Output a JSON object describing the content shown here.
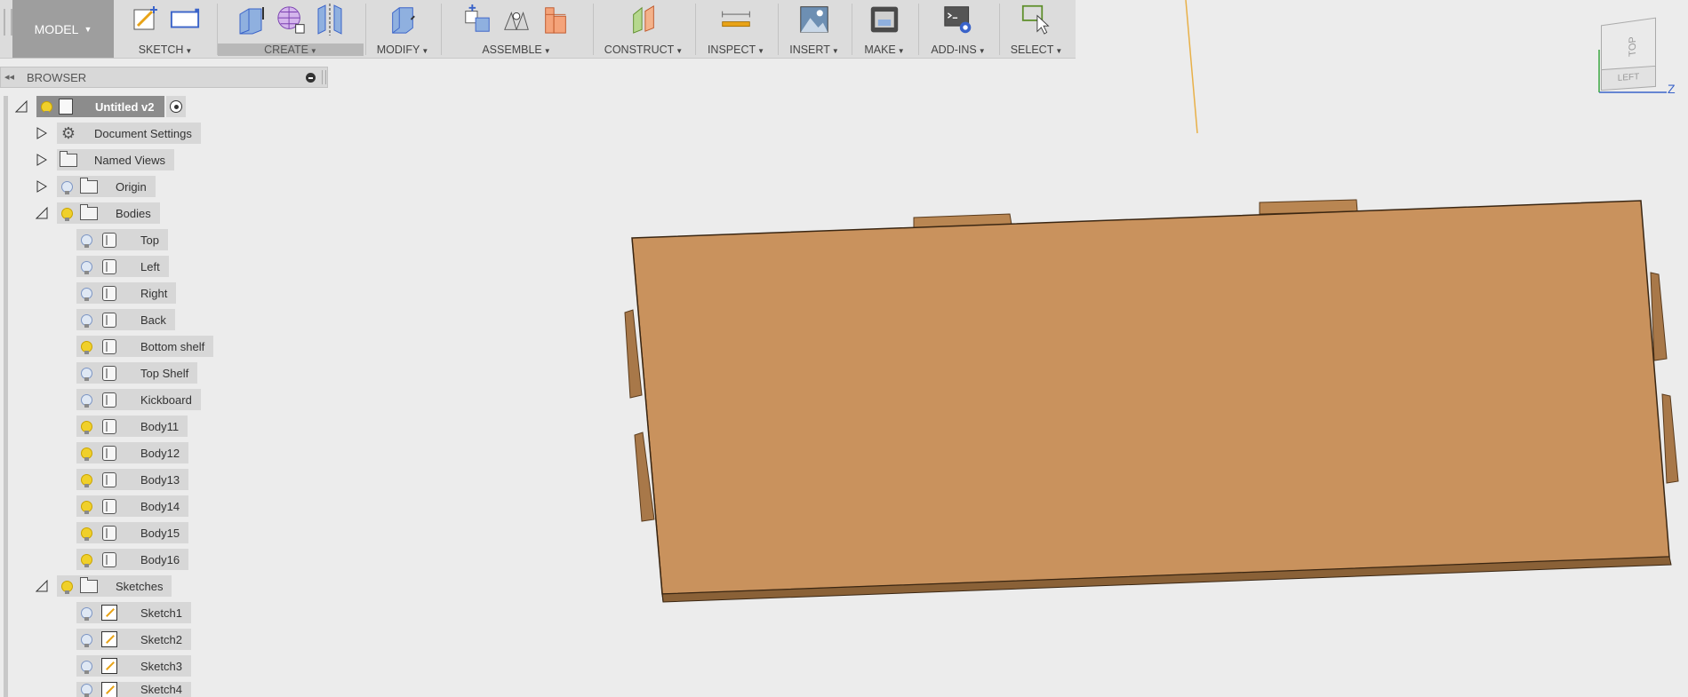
{
  "toolbar": {
    "workspace": "MODEL",
    "groups": [
      {
        "label": "SKETCH",
        "active": false
      },
      {
        "label": "CREATE",
        "active": true
      },
      {
        "label": "MODIFY",
        "active": false
      },
      {
        "label": "ASSEMBLE",
        "active": false
      },
      {
        "label": "CONSTRUCT",
        "active": false
      },
      {
        "label": "INSPECT",
        "active": false
      },
      {
        "label": "INSERT",
        "active": false
      },
      {
        "label": "MAKE",
        "active": false
      },
      {
        "label": "ADD-INS",
        "active": false
      },
      {
        "label": "SELECT",
        "active": false
      }
    ]
  },
  "browser": {
    "title": "BROWSER",
    "root": "Untitled v2",
    "items": [
      {
        "label": "Document Settings"
      },
      {
        "label": "Named Views"
      },
      {
        "label": "Origin"
      },
      {
        "label": "Bodies"
      }
    ],
    "bodies": [
      {
        "label": "Top",
        "visible": false
      },
      {
        "label": "Left",
        "visible": false
      },
      {
        "label": "Right",
        "visible": false
      },
      {
        "label": "Back",
        "visible": false
      },
      {
        "label": "Bottom shelf",
        "visible": true
      },
      {
        "label": "Top Shelf",
        "visible": false
      },
      {
        "label": "Kickboard",
        "visible": false
      },
      {
        "label": "Body11",
        "visible": true
      },
      {
        "label": "Body12",
        "visible": true
      },
      {
        "label": "Body13",
        "visible": true
      },
      {
        "label": "Body14",
        "visible": true
      },
      {
        "label": "Body15",
        "visible": true
      },
      {
        "label": "Body16",
        "visible": true
      }
    ],
    "sketches_label": "Sketches",
    "sketches": [
      {
        "label": "Sketch1"
      },
      {
        "label": "Sketch2"
      },
      {
        "label": "Sketch3"
      },
      {
        "label": "Sketch4"
      }
    ]
  },
  "viewcube": {
    "top": "TOP",
    "left": "LEFT",
    "axis": "Z"
  },
  "colors": {
    "toolbar_bg": "#dcdcdc",
    "workspace_bg": "#9e9e9e",
    "canvas_bg": "#ececec",
    "board_fill": "#c9925d",
    "board_edge": "#8a6137",
    "bulb_on": "#f0d02a",
    "bulb_off": "#dfe8f4"
  }
}
